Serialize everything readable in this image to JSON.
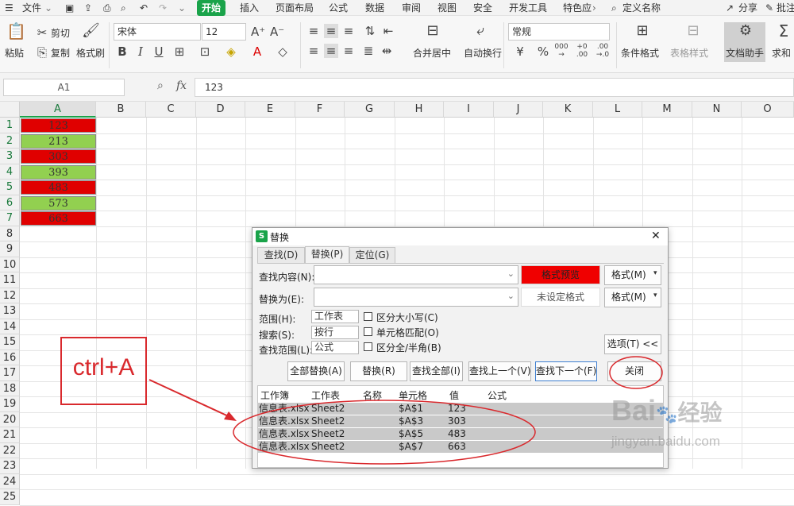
{
  "menubar": {
    "file": "文件",
    "tabs": [
      "开始",
      "插入",
      "页面布局",
      "公式",
      "数据",
      "审阅",
      "视图",
      "安全",
      "开发工具",
      "特色应"
    ],
    "search": "定义名称",
    "share": "分享",
    "comment": "批注"
  },
  "ribbon": {
    "paste": "粘贴",
    "cut": "剪切",
    "copy": "复制",
    "format_painter": "格式刷",
    "font_name": "宋体",
    "font_size": "12",
    "merge": "合并居中",
    "wrap": "自动换行",
    "number_format": "常规",
    "conditional_format": "条件格式",
    "table_style": "表格样式",
    "doc_assistant": "文档助手",
    "sum": "求和",
    "bold": "B",
    "italic": "I",
    "underline": "U",
    "percent": "%"
  },
  "formula": {
    "cell_ref": "A1",
    "fx": "fx",
    "value": "123"
  },
  "sheet": {
    "columns": [
      "A",
      "B",
      "C",
      "D",
      "E",
      "F",
      "G",
      "H",
      "I",
      "J",
      "K",
      "L",
      "M",
      "N",
      "O"
    ],
    "rows": [
      "1",
      "2",
      "3",
      "4",
      "5",
      "6",
      "7",
      "8",
      "9",
      "10",
      "11",
      "12",
      "13",
      "14",
      "15",
      "16",
      "17",
      "18",
      "19",
      "20",
      "21",
      "22",
      "23",
      "24",
      "25"
    ],
    "cells": [
      "123",
      "213",
      "303",
      "393",
      "483",
      "573",
      "663"
    ],
    "fill_colors": [
      "#e00000",
      "#92d050",
      "#e00000",
      "#92d050",
      "#e00000",
      "#92d050",
      "#e00000"
    ]
  },
  "annotation": {
    "text": "ctrl+A",
    "color": "#d9292d"
  },
  "dialog": {
    "title": "替换",
    "close_glyph": "✕",
    "tabs": [
      "查找(D)",
      "替换(P)",
      "定位(G)"
    ],
    "find_label": "查找内容(N):",
    "replace_label": "替换为(E):",
    "format_preview": "格式预览",
    "not_set_format": "未设定格式",
    "format_button": "格式(M)",
    "scope_label": "范围(H):",
    "scope_value": "工作表",
    "search_label": "搜索(S):",
    "search_value": "按行",
    "lookin_label": "查找范围(L):",
    "lookin_value": "公式",
    "match_case": "区分大小写(C)",
    "match_cell": "单元格匹配(O)",
    "match_width": "区分全/半角(B)",
    "options_button": "选项(T) <<",
    "replace_all": "全部替换(A)",
    "replace": "替换(R)",
    "find_all": "查找全部(I)",
    "find_prev": "查找上一个(V)",
    "find_next": "查找下一个(F)",
    "close": "关闭",
    "results_headers": [
      "工作簿",
      "工作表",
      "名称",
      "单元格",
      "值",
      "公式"
    ],
    "results": [
      {
        "book": "信息表.xlsx",
        "sheet": "Sheet2",
        "cell": "$A$1",
        "value": "123"
      },
      {
        "book": "信息表.xlsx",
        "sheet": "Sheet2",
        "cell": "$A$3",
        "value": "303"
      },
      {
        "book": "信息表.xlsx",
        "sheet": "Sheet2",
        "cell": "$A$5",
        "value": "483"
      },
      {
        "book": "信息表.xlsx",
        "sheet": "Sheet2",
        "cell": "$A$7",
        "value": "663"
      }
    ]
  },
  "watermark": {
    "brand": "Bai",
    "brand2": "经验",
    "url": "jingyan.baidu.com"
  }
}
